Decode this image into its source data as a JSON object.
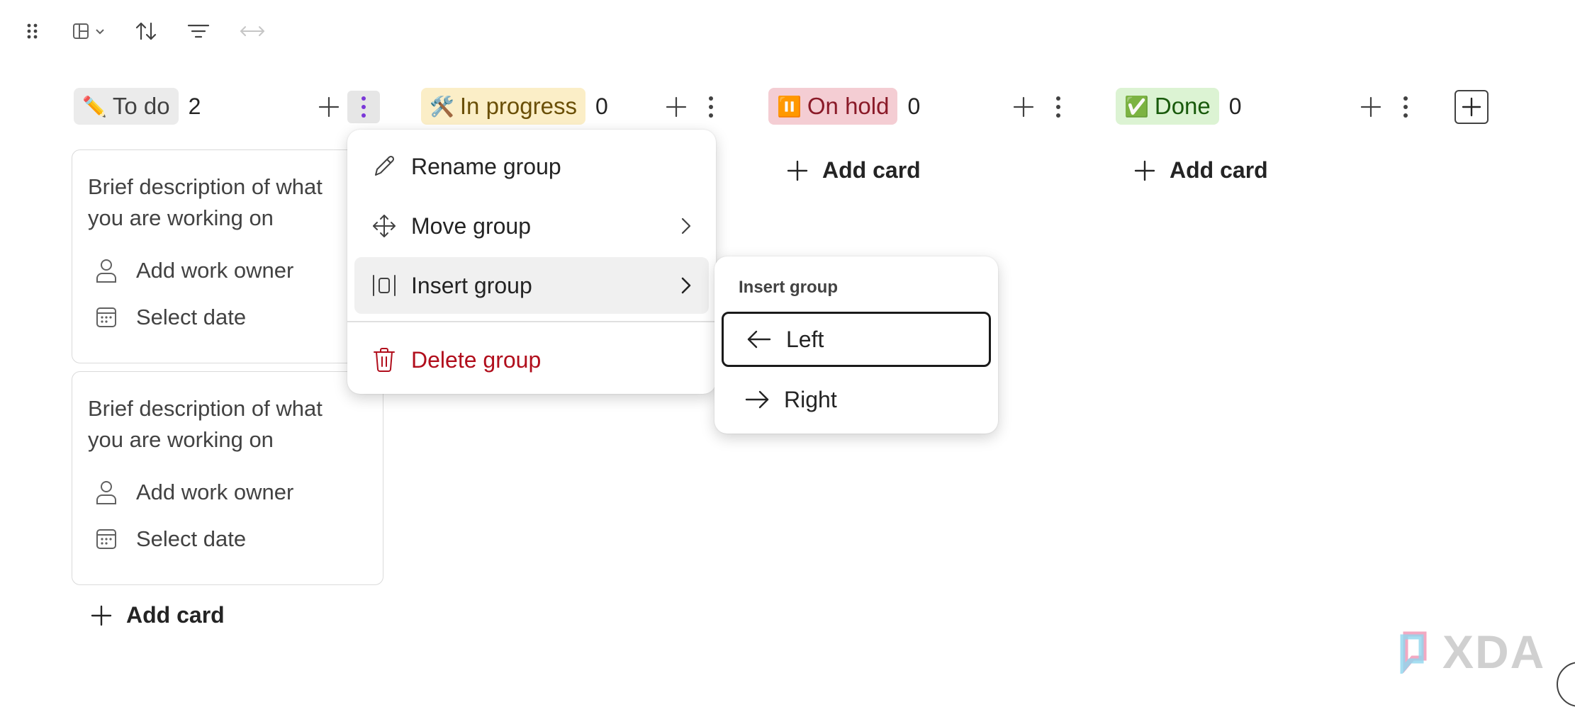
{
  "toolbar": {
    "icons": [
      "drag-handle-icon",
      "view-layout-icon",
      "sort-icon",
      "filter-icon",
      "expand-horizontal-icon"
    ]
  },
  "columns": [
    {
      "emoji": "✏️",
      "label": "To do",
      "count": "2",
      "chip_bg": "#ebebeb",
      "chip_color": "#424242"
    },
    {
      "emoji": "🛠️",
      "label": "In progress",
      "count": "0",
      "chip_bg": "#fbeec7",
      "chip_color": "#6a4f07"
    },
    {
      "emoji": "⏸️",
      "label": "On hold",
      "count": "0",
      "chip_bg": "#f4cdd3",
      "chip_color": "#8a1a28"
    },
    {
      "emoji": "✅",
      "label": "Done",
      "count": "0",
      "chip_bg": "#dcf3d3",
      "chip_color": "#195a0c"
    }
  ],
  "cards": [
    {
      "description": "Brief description of what you are working on",
      "owner": "Add work owner",
      "date": "Select date"
    },
    {
      "description": "Brief description of what you are working on",
      "owner": "Add work owner",
      "date": "Select date"
    }
  ],
  "add_card_label": "Add card",
  "context_menu": {
    "items": [
      {
        "label": "Rename group",
        "icon": "pencil-icon"
      },
      {
        "label": "Move group",
        "icon": "move-arrows-icon"
      },
      {
        "label": "Insert group",
        "icon": "insert-column-icon"
      },
      {
        "label": "Delete group",
        "icon": "trash-icon"
      }
    ]
  },
  "submenu": {
    "title": "Insert group",
    "items": [
      {
        "label": "Left",
        "icon": "arrow-left-icon"
      },
      {
        "label": "Right",
        "icon": "arrow-right-icon"
      }
    ]
  },
  "watermark": {
    "text": "XDA"
  },
  "colors": {
    "accent": "#7b38d8",
    "danger": "#b10e1c"
  }
}
